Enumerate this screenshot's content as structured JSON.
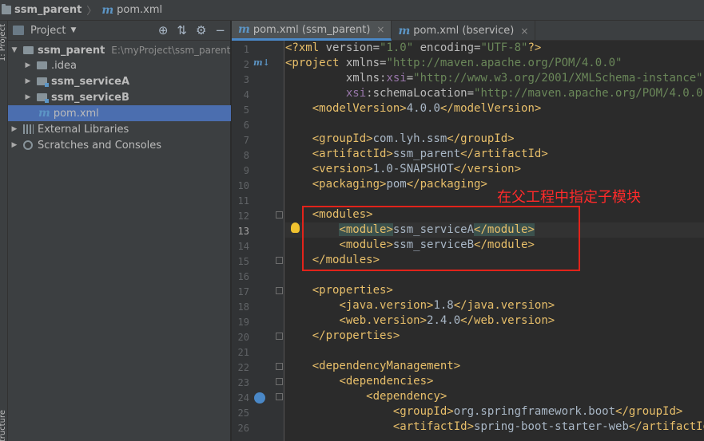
{
  "breadcrumb": {
    "project": "ssm_parent",
    "file": "pom.xml"
  },
  "left_strip": {
    "top_label": "1: Project",
    "bottom_label": "Structure"
  },
  "project_panel": {
    "title": "Project",
    "tree": [
      {
        "label": "ssm_parent",
        "path": "E:\\myProject\\ssm_parent",
        "expanded": true,
        "icon": "folder-icon"
      },
      {
        "label": ".idea",
        "icon": "folder-icon"
      },
      {
        "label": "ssm_serviceA",
        "icon": "module-folder-icon"
      },
      {
        "label": "ssm_serviceB",
        "icon": "module-folder-icon"
      },
      {
        "label": "pom.xml",
        "icon": "maven-icon",
        "selected": true
      },
      {
        "label": "External Libraries",
        "icon": "libraries-icon"
      },
      {
        "label": "Scratches and Consoles",
        "icon": "scratches-icon"
      }
    ]
  },
  "tabs": [
    {
      "label": "pom.xml (ssm_parent)",
      "active": true
    },
    {
      "label": "pom.xml (bservice)",
      "active": false
    }
  ],
  "editor": {
    "current_line": 13,
    "line_numbers": [
      "1",
      "2",
      "3",
      "4",
      "5",
      "6",
      "7",
      "8",
      "9",
      "10",
      "11",
      "12",
      "13",
      "14",
      "15",
      "16",
      "17",
      "18",
      "19",
      "20",
      "21",
      "22",
      "23",
      "24",
      "25",
      "26"
    ],
    "annotation": "在父工程中指定子模块"
  },
  "colors": {
    "accent": "#4a88c7",
    "selection": "#4b6eaf",
    "annotation_red": "#e2231a",
    "tag": "#e8bf6a",
    "string": "#6a8759"
  }
}
